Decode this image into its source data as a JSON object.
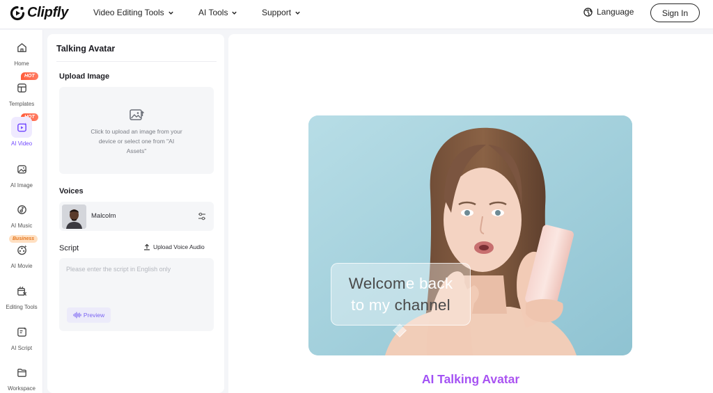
{
  "brand": {
    "name": "Clipfly"
  },
  "nav": {
    "items": [
      {
        "label": "Video Editing Tools"
      },
      {
        "label": "AI Tools"
      },
      {
        "label": "Support"
      }
    ],
    "language_label": "Language",
    "signin_label": "Sign In"
  },
  "sidebar": {
    "items": [
      {
        "label": "Home",
        "icon": "home-icon"
      },
      {
        "label": "Templates",
        "icon": "templates-icon",
        "badge": "HOT"
      },
      {
        "label": "AI Video",
        "icon": "ai-video-icon",
        "badge": "HOT",
        "active": true
      },
      {
        "label": "AI Image",
        "icon": "ai-image-icon"
      },
      {
        "label": "AI Music",
        "icon": "ai-music-icon"
      },
      {
        "label": "AI Movie",
        "icon": "ai-movie-icon",
        "badge": "Business"
      },
      {
        "label": "Editing Tools",
        "icon": "editing-tools-icon"
      },
      {
        "label": "AI Script",
        "icon": "ai-script-icon"
      },
      {
        "label": "Workspace",
        "icon": "workspace-icon"
      }
    ]
  },
  "panel": {
    "title": "Talking Avatar",
    "upload": {
      "title": "Upload Image",
      "hint": "Click to upload an image from your device or select one from \"AI Assets\""
    },
    "voices": {
      "title": "Voices",
      "selected": "Malcolm"
    },
    "script": {
      "title": "Script",
      "upload_audio_label": "Upload Voice Audio",
      "placeholder": "Please enter the script in English only",
      "preview_label": "Preview"
    }
  },
  "main": {
    "bubble_line1_dark": "Welcom",
    "bubble_line1_light": "e back",
    "bubble_line2_light": "to my ",
    "bubble_line2_dark": "channel",
    "title": "AI Talking Avatar"
  },
  "colors": {
    "accent": "#6f45ff",
    "hot_badge": "#ff5c3a",
    "business_badge": "#ffe0c2",
    "hero_bg": "#a7d3df"
  }
}
